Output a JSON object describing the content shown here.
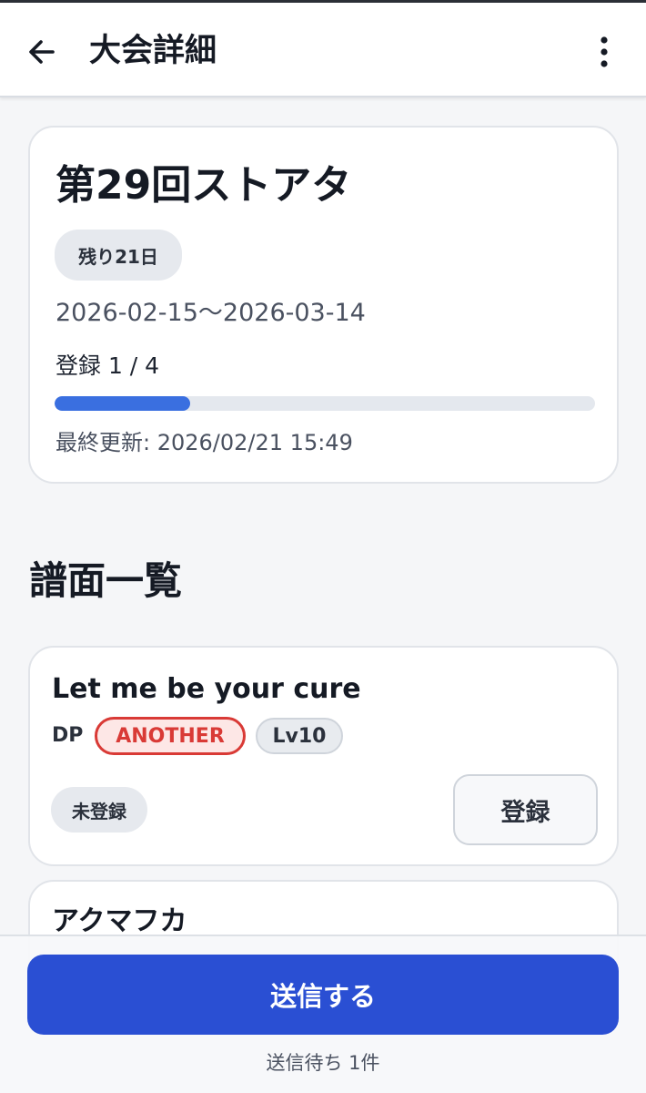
{
  "header": {
    "title": "大会詳細",
    "back_icon": "arrow-left-icon",
    "menu_icon": "more-vertical-icon"
  },
  "tournament": {
    "name": "第29回ストアタ",
    "days_left": "残り21日",
    "date_range": "2026-02-15〜2026-03-14",
    "registration": "登録 1 / 4",
    "progress": 0.25,
    "last_updated": "最終更新: 2026/02/21 15:49"
  },
  "charts_section": {
    "title": "譜面一覧",
    "songs": [
      {
        "title": "Let me be your cure",
        "play_style": "DP",
        "difficulty": "ANOTHER",
        "level": "Lv10",
        "status": "未登録",
        "action_label": "登録"
      },
      {
        "title": "アクマフカ"
      }
    ]
  },
  "footer": {
    "submit_label": "送信する",
    "pending_text": "送信待ち 1件"
  },
  "colors": {
    "accent": "#2a4fd3",
    "progress": "#3a6fe0",
    "another": "#d93a36",
    "background": "#f5f6f8"
  }
}
